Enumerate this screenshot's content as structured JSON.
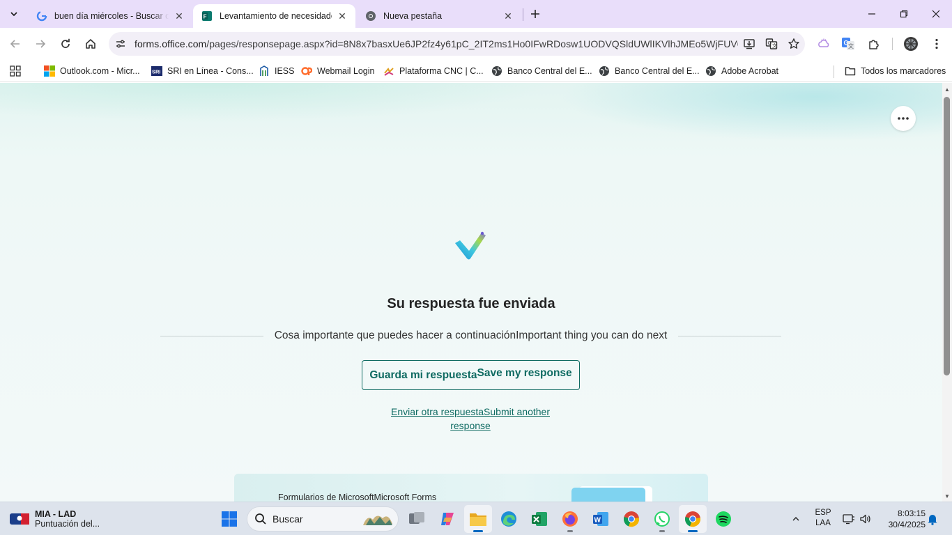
{
  "browser": {
    "tabs": [
      {
        "title": "buen día miércoles - Buscar con Google",
        "icon": "google-icon",
        "active": false
      },
      {
        "title": "Levantamiento de necesidades",
        "icon": "microsoft-forms-icon",
        "active": true
      },
      {
        "title": "Nueva pestaña",
        "icon": "chrome-icon",
        "active": false
      }
    ],
    "url_host": "forms.office.com",
    "url_path": "/pages/responsepage.aspx?id=8N8x7basxUe6JP2fz4y61pC_2IT2ms1Ho0IFwRDosw1UODVQSldUWlIKVlhJMEo5WjFUV0...",
    "bookmarks": [
      {
        "label": "Outlook.com - Micr...",
        "icon": "microsoft-icon"
      },
      {
        "label": "SRI en Línea - Cons...",
        "icon": "sri-icon"
      },
      {
        "label": "IESS",
        "icon": "iess-icon"
      },
      {
        "label": "Webmail Login",
        "icon": "cpanel-icon"
      },
      {
        "label": "Plataforma CNC | C...",
        "icon": "cnc-icon"
      },
      {
        "label": "Banco Central del E...",
        "icon": "globe-icon"
      },
      {
        "label": "Banco Central del E...",
        "icon": "globe-icon"
      },
      {
        "label": "Adobe Acrobat",
        "icon": "globe-icon"
      }
    ],
    "all_bookmarks_label": "Todos los marcadores"
  },
  "page": {
    "title": "Su respuesta fue enviada",
    "next_label": "Cosa importante que puedes hacer a continuaciónImportant thing you can do next",
    "save_label_es": "Guarda mi respuesta",
    "save_label_en": "Save my response",
    "another_label": "Enviar otra respuestaSubmit another response",
    "footer_label": "Formularios de MicrosoftMicrosoft Forms"
  },
  "taskbar": {
    "weather_title": "MIA - LAD",
    "weather_sub": "Puntuación del...",
    "search_placeholder": "Buscar",
    "lang_line1": "ESP",
    "lang_line2": "LAA",
    "time": "8:03:15",
    "date": "30/4/2025"
  },
  "colors": {
    "accent": "#0f6b62",
    "tabstrip": "#e9defa",
    "taskbar": "#dde3ec"
  }
}
